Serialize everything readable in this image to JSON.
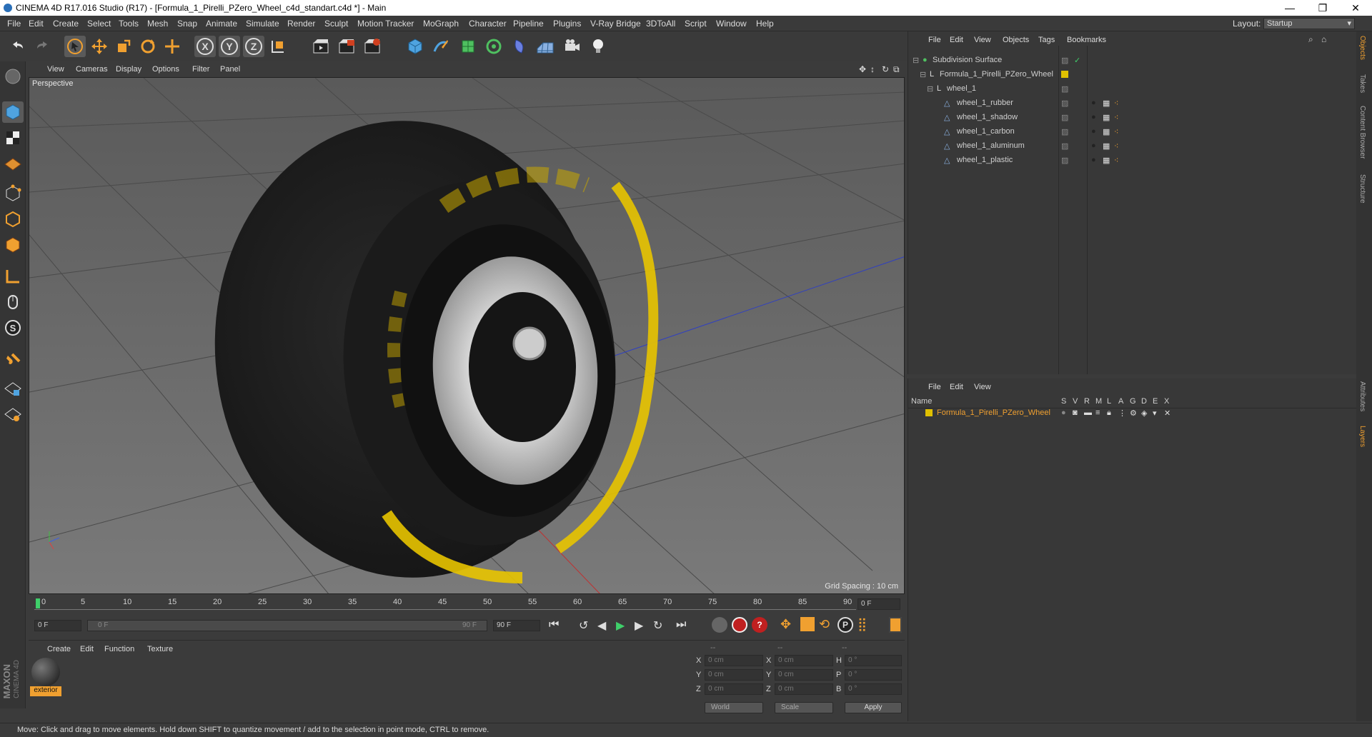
{
  "window": {
    "title": "CINEMA 4D R17.016 Studio (R17) - [Formula_1_Pirelli_PZero_Wheel_c4d_standart.c4d *] - Main",
    "minimize": "—",
    "restore": "❐",
    "close": "✕"
  },
  "menubar": {
    "items": [
      "File",
      "Edit",
      "Create",
      "Select",
      "Tools",
      "Mesh",
      "Snap",
      "Animate",
      "Simulate",
      "Render",
      "Sculpt",
      "Motion Tracker",
      "MoGraph",
      "Character",
      "Pipeline",
      "Plugins",
      "V-Ray Bridge",
      "3DToAll",
      "Script",
      "Window",
      "Help"
    ],
    "layout_label": "Layout:",
    "layout_value": "Startup"
  },
  "toolbar": {
    "icons": [
      "undo-icon",
      "redo-icon",
      "select-arrow-icon",
      "move-icon",
      "scale-icon",
      "rotate-icon",
      "live-select-icon",
      "x-axis-icon",
      "y-axis-icon",
      "z-axis-icon",
      "world-coordinates-icon",
      "render-view-icon",
      "render-picture-viewer-icon",
      "edit-render-settings-icon",
      "cube-icon",
      "pen-spline-icon",
      "subdivision-icon",
      "cloner-icon",
      "deformer-icon",
      "floor-icon",
      "camera-icon",
      "light-icon"
    ],
    "axis_labels": [
      "X",
      "Y",
      "Z"
    ]
  },
  "viewport": {
    "menu": [
      "View",
      "Cameras",
      "Display",
      "Options",
      "Filter",
      "Panel"
    ],
    "label": "Perspective",
    "grid_spacing": "Grid Spacing : 10 cm"
  },
  "timeline": {
    "ticks": [
      "0",
      "5",
      "10",
      "15",
      "20",
      "25",
      "30",
      "35",
      "40",
      "45",
      "50",
      "55",
      "60",
      "65",
      "70",
      "75",
      "80",
      "85",
      "90"
    ],
    "current_frame": "0 F",
    "start": "0 F",
    "range_start": "0 F",
    "range_end": "90 F",
    "end": "90 F"
  },
  "material_manager": {
    "menu": [
      "Create",
      "Edit",
      "Function",
      "Texture"
    ],
    "material_name": "exterior"
  },
  "coordinates": {
    "header": [
      "--",
      "--",
      "--"
    ],
    "rows": [
      {
        "a": "X",
        "av": "0 cm",
        "b": "X",
        "bv": "0 cm",
        "c": "H",
        "cv": "0 °"
      },
      {
        "a": "Y",
        "av": "0 cm",
        "b": "Y",
        "bv": "0 cm",
        "c": "P",
        "cv": "0 °"
      },
      {
        "a": "Z",
        "av": "0 cm",
        "b": "Z",
        "bv": "0 cm",
        "c": "B",
        "cv": "0 °"
      }
    ],
    "mode": "World",
    "scale": "Scale",
    "apply": "Apply"
  },
  "object_manager": {
    "menu": [
      "File",
      "Edit",
      "View",
      "Objects",
      "Tags",
      "Bookmarks"
    ],
    "objects": [
      {
        "name": "Subdivision Surface",
        "indent": 0,
        "color": "#cfcfcf"
      },
      {
        "name": "Formula_1_Pirelli_PZero_Wheel",
        "indent": 1,
        "color": "#cfcfcf"
      },
      {
        "name": "wheel_1",
        "indent": 2,
        "color": "#cfcfcf"
      },
      {
        "name": "wheel_1_rubber",
        "indent": 3,
        "color": "#cfcfcf"
      },
      {
        "name": "wheel_1_shadow",
        "indent": 3,
        "color": "#cfcfcf"
      },
      {
        "name": "wheel_1_carbon",
        "indent": 3,
        "color": "#cfcfcf"
      },
      {
        "name": "wheel_1_aluminum",
        "indent": 3,
        "color": "#cfcfcf"
      },
      {
        "name": "wheel_1_plastic",
        "indent": 3,
        "color": "#cfcfcf"
      }
    ]
  },
  "layer_manager": {
    "menu": [
      "File",
      "Edit",
      "View"
    ],
    "columns": [
      "Name",
      "S",
      "V",
      "R",
      "M",
      "L",
      "A",
      "G",
      "D",
      "E",
      "X"
    ],
    "layer": "Formula_1_Pirelli_PZero_Wheel",
    "layer_color": "#e0c000"
  },
  "side_tabs": [
    "Objects",
    "Takes",
    "Content Browser",
    "Structure",
    "Attributes",
    "Layers"
  ],
  "maxon": {
    "brand": "MAXON",
    "product": "CINEMA 4D"
  },
  "status": "Move: Click and drag to move elements. Hold down SHIFT to quantize movement / add to the selection in point mode, CTRL to remove.",
  "colors": {
    "accent": "#3f8fd6",
    "selected_orange": "#f0a030",
    "tire_yellow": "#e8c400"
  }
}
